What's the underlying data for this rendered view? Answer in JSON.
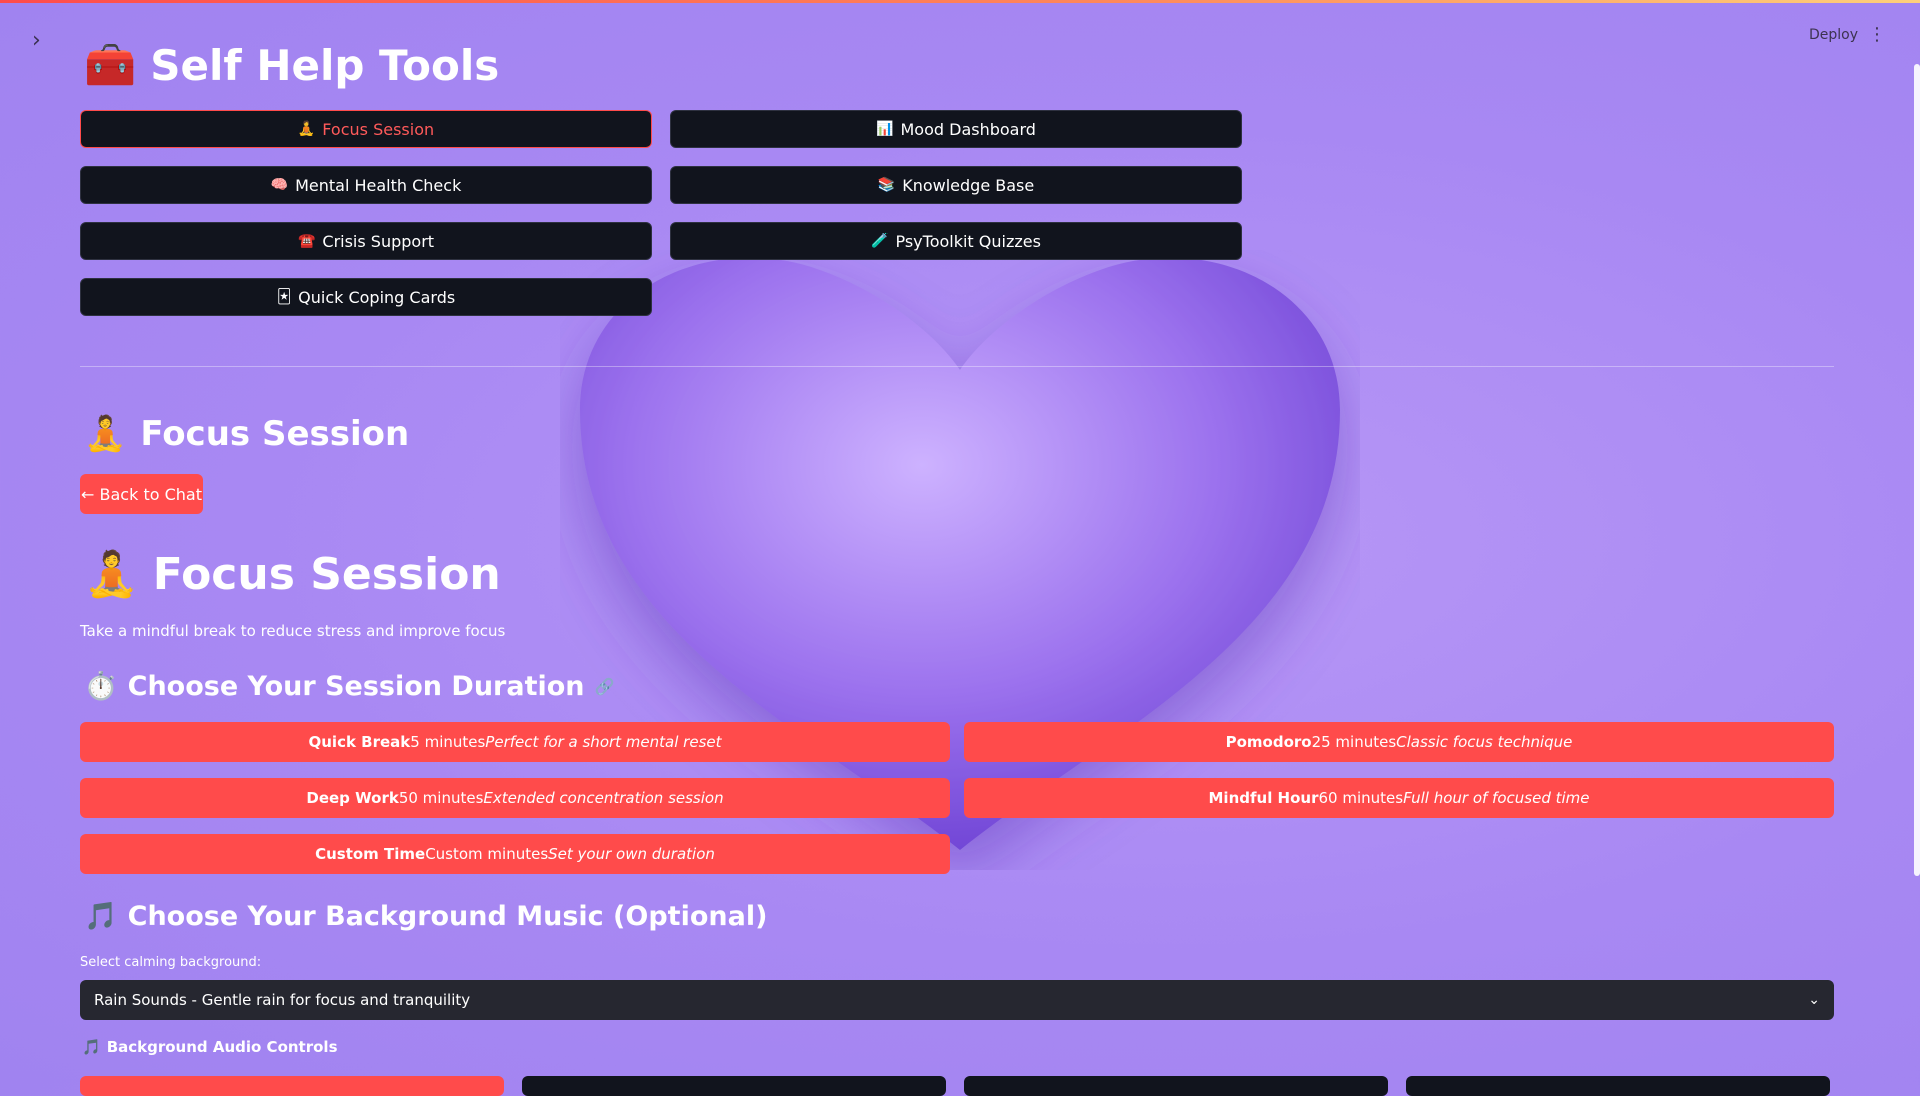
{
  "header": {
    "deploy_label": "Deploy",
    "sidebar_toggle": "›",
    "menu_icon": "⋮"
  },
  "page_title": {
    "emoji": "🧰",
    "text": "Self Help Tools"
  },
  "tools": [
    {
      "icon": "🧘",
      "label": "Focus Session",
      "active": true
    },
    {
      "icon": "📊",
      "label": "Mood Dashboard",
      "active": false
    },
    {
      "icon": "🧠",
      "label": "Mental Health Check",
      "active": false
    },
    {
      "icon": "📚",
      "label": "Knowledge Base",
      "active": false
    },
    {
      "icon": "☎️",
      "label": "Crisis Support",
      "active": false
    },
    {
      "icon": "🧪",
      "label": "PsyToolkit Quizzes",
      "active": false
    },
    {
      "icon": "🃏",
      "label": "Quick Coping Cards",
      "active": false
    }
  ],
  "section": {
    "emoji": "🧘",
    "title": "Focus Session",
    "back_label": "← Back to Chat"
  },
  "focus": {
    "emoji": "🧘",
    "title": "Focus Session",
    "subtitle": "Take a mindful break to reduce stress and improve focus",
    "duration_heading": {
      "emoji": "⏱️",
      "text": "Choose Your Session Duration",
      "link_icon": "🔗"
    },
    "durations": [
      {
        "name": "Quick Break",
        "minutes": "5 minutes",
        "desc": "Perfect for a short mental reset"
      },
      {
        "name": "Pomodoro",
        "minutes": "25 minutes",
        "desc": "Classic focus technique"
      },
      {
        "name": "Deep Work",
        "minutes": "50 minutes",
        "desc": "Extended concentration session"
      },
      {
        "name": "Mindful Hour",
        "minutes": "60 minutes",
        "desc": "Full hour of focused time"
      },
      {
        "name": "Custom Time",
        "minutes": "Custom minutes",
        "desc": "Set your own duration"
      }
    ],
    "music_heading": {
      "emoji": "🎵",
      "text": "Choose Your Background Music (Optional)"
    },
    "select_label": "Select calming background:",
    "select_value": "Rain Sounds - Gentle rain for focus and tranquility",
    "audio_controls": {
      "emoji": "🎵",
      "text": "Background Audio Controls"
    }
  },
  "colors": {
    "accent": "#ff4b4b",
    "button_dark": "#11141d",
    "select_bg": "#262730",
    "bg": "#a888f3"
  }
}
